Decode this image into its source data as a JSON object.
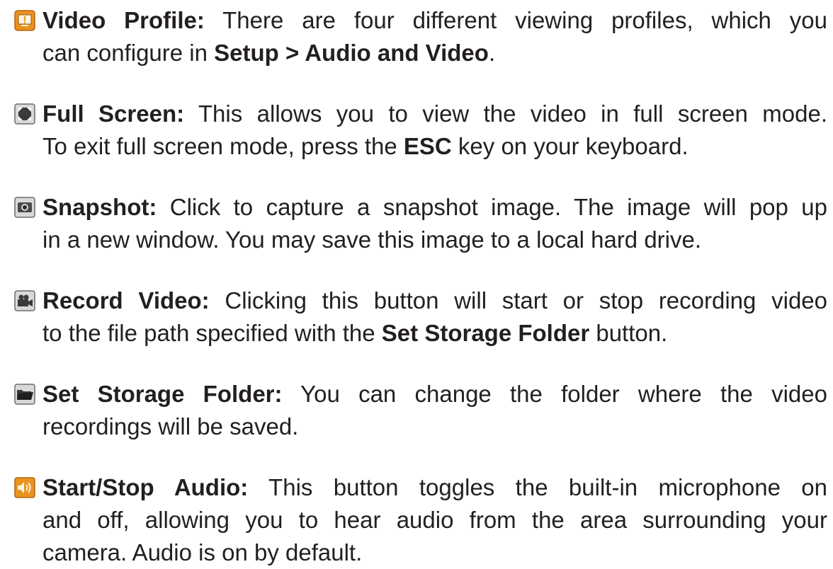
{
  "items": [
    {
      "icon": "video-profile-icon",
      "term": "Video Profile:",
      "lines": [
        {
          "parts": [
            {
              "t": " There are four different viewing profiles, which you"
            }
          ]
        },
        {
          "parts": [
            {
              "t": "can configure in "
            },
            {
              "b": "Setup > Audio and Video"
            },
            {
              "t": "."
            }
          ]
        }
      ]
    },
    {
      "icon": "full-screen-icon",
      "term": "Full Screen:",
      "lines": [
        {
          "parts": [
            {
              "t": " This allows you to view the video in full screen mode."
            }
          ]
        },
        {
          "parts": [
            {
              "t": "To exit full screen mode, press the "
            },
            {
              "b": "ESC"
            },
            {
              "t": " key on your keyboard."
            }
          ]
        }
      ]
    },
    {
      "icon": "snapshot-icon",
      "term": "Snapshot:",
      "lines": [
        {
          "parts": [
            {
              "t": " Click to capture a snapshot image. The image will pop up"
            }
          ]
        },
        {
          "parts": [
            {
              "t": "in a new window. You may save this image to a local hard drive."
            }
          ]
        }
      ]
    },
    {
      "icon": "record-video-icon",
      "term": "Record Video:",
      "lines": [
        {
          "parts": [
            {
              "t": " Clicking this button will start or stop recording video"
            }
          ]
        },
        {
          "parts": [
            {
              "t": "to the file path specified with the "
            },
            {
              "b": "Set Storage Folder"
            },
            {
              "t": " button."
            }
          ]
        }
      ]
    },
    {
      "icon": "storage-folder-icon",
      "term": "Set Storage Folder:",
      "lines": [
        {
          "parts": [
            {
              "t": " You can change the folder where the video"
            }
          ]
        },
        {
          "parts": [
            {
              "t": "recordings will be saved."
            }
          ]
        }
      ]
    },
    {
      "icon": "audio-speaker-icon",
      "term": "Start/Stop Audio:",
      "lines": [
        {
          "parts": [
            {
              "t": " This button toggles the built-in microphone on"
            }
          ]
        },
        {
          "parts": [
            {
              "t": "and off, allowing you to hear audio from the area surrounding your"
            }
          ]
        },
        {
          "parts": [
            {
              "t": "camera. Audio is on by default."
            }
          ]
        }
      ]
    }
  ]
}
